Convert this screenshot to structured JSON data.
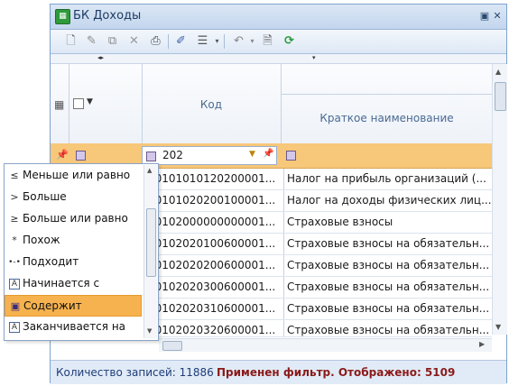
{
  "window": {
    "title": "БК Доходы",
    "icon": "table-icon"
  },
  "toolbar": {
    "icons": [
      "new-icon",
      "edit-icon",
      "copy-icon",
      "delete-icon",
      "print-icon",
      "paint-icon",
      "list-icon",
      "undo-icon",
      "preview-icon",
      "refresh-icon"
    ]
  },
  "grid": {
    "columns": {
      "code": "Код",
      "short_name": "Краткое наименование"
    },
    "filter": {
      "code_value": "202"
    },
    "rows": [
      {
        "code": "00101010120200001...",
        "name": "Налог на прибыль организаций (..."
      },
      {
        "code": "00101020200100001...",
        "name": "Налог на доходы физических лиц..."
      },
      {
        "code": "00102000000000001...",
        "name": "Страховые взносы"
      },
      {
        "code": "00102020100600001...",
        "name": "Страховые взносы на обязательн..."
      },
      {
        "code": "00102020200600001...",
        "name": "Страховые взносы на обязательн..."
      },
      {
        "code": "00102020300600001...",
        "name": "Страховые взносы на обязательн..."
      },
      {
        "code": "00102020310600001...",
        "name": "Страховые взносы на обязательн..."
      },
      {
        "code": "00102020320600001...",
        "name": "Страховые взносы на обязательн..."
      }
    ]
  },
  "filter_menu": {
    "items": [
      {
        "icon": "≤",
        "label": "Меньше или равно"
      },
      {
        "icon": ">",
        "label": "Больше"
      },
      {
        "icon": "≥",
        "label": "Больше или равно"
      },
      {
        "icon": "*",
        "label": "Похож"
      },
      {
        "icon": "•-•",
        "label": "Подходит"
      },
      {
        "icon": "A",
        "label": "Начинается с"
      },
      {
        "icon": "▣",
        "label": "Содержит"
      },
      {
        "icon": "A",
        "label": "Заканчивается на"
      }
    ],
    "selected": "Содержит"
  },
  "status": {
    "count": "Количество записей: 11886",
    "filter": "Применен фильтр. Отображено: 5109"
  },
  "colors": {
    "filter_row": "#f7c77a",
    "selected_item": "#f6b24e",
    "status_filter": "#8b1a1a",
    "status_count": "#1e3c78"
  }
}
